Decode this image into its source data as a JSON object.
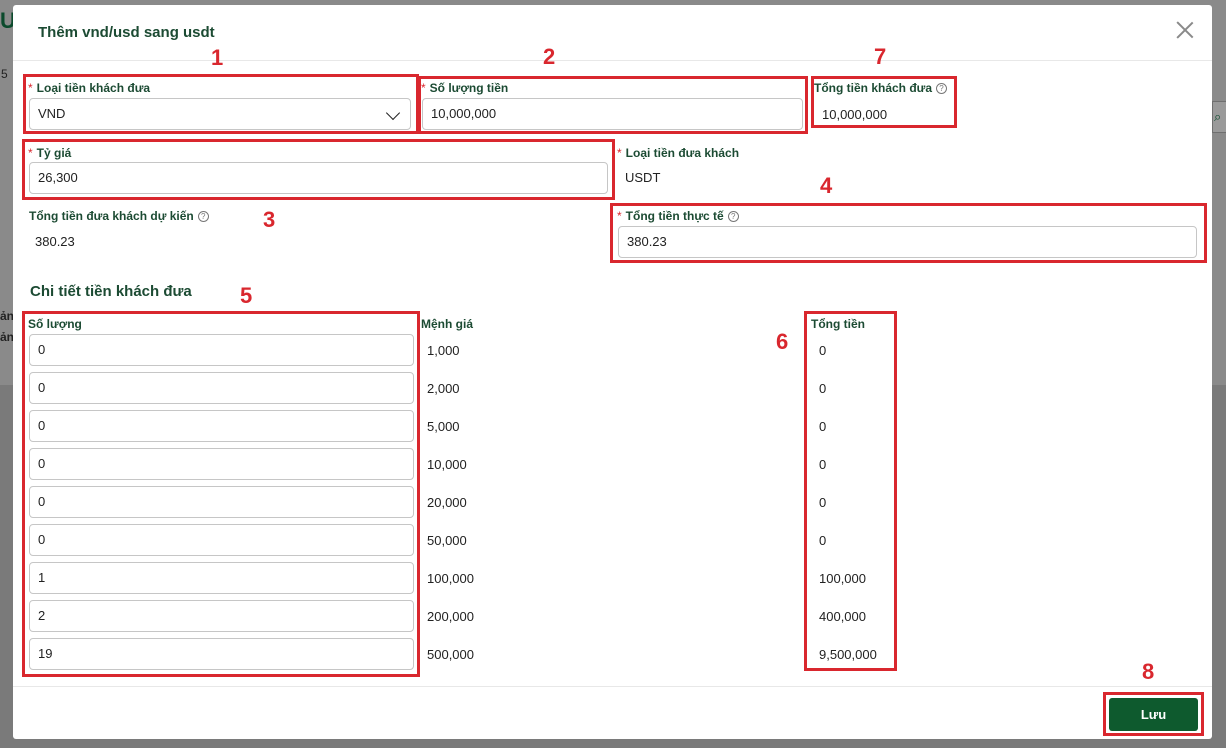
{
  "background": {
    "title_fragment": "US",
    "number_fragment": "5",
    "row_fragments": [
      "ản",
      "ản"
    ]
  },
  "modal": {
    "title": "Thêm vnd/usd sang usdt",
    "close_icon": "close-icon",
    "fields": {
      "currency_given": {
        "label": "Loại tiền khách đưa",
        "value": "VND",
        "required": "*"
      },
      "amount": {
        "label": "Số lượng tiền",
        "value": "10,000,000",
        "required": "*"
      },
      "total_given": {
        "label": "Tổng tiền khách đưa",
        "value": "10,000,000"
      },
      "rate": {
        "label": "Tỷ giá",
        "value": "26,300",
        "required": "*"
      },
      "currency_out": {
        "label": "Loại tiền đưa khách",
        "value": "USDT",
        "required": "*"
      },
      "expected_total": {
        "label": "Tổng tiền đưa khách dự kiến",
        "value": "380.23"
      },
      "actual_total": {
        "label": "Tổng tiền thực tế",
        "value": "380.23",
        "required": "*"
      }
    },
    "details": {
      "title": "Chi tiết tiền khách đưa",
      "headers": {
        "quantity": "Số lượng",
        "denomination": "Mệnh giá",
        "total": "Tổng tiền"
      },
      "rows": [
        {
          "quantity": "0",
          "denomination": "1,000",
          "total": "0"
        },
        {
          "quantity": "0",
          "denomination": "2,000",
          "total": "0"
        },
        {
          "quantity": "0",
          "denomination": "5,000",
          "total": "0"
        },
        {
          "quantity": "0",
          "denomination": "10,000",
          "total": "0"
        },
        {
          "quantity": "0",
          "denomination": "20,000",
          "total": "0"
        },
        {
          "quantity": "0",
          "denomination": "50,000",
          "total": "0"
        },
        {
          "quantity": "1",
          "denomination": "100,000",
          "total": "100,000"
        },
        {
          "quantity": "2",
          "denomination": "200,000",
          "total": "400,000"
        },
        {
          "quantity": "19",
          "denomination": "500,000",
          "total": "9,500,000"
        }
      ]
    },
    "save_label": "Lưu"
  },
  "annotations": [
    "1",
    "2",
    "7",
    "3",
    "4",
    "5",
    "6",
    "8"
  ],
  "colors": {
    "accent": "#1c4b33",
    "button": "#0e5a2e",
    "annotation": "#d9272e",
    "required": "#d9272e"
  }
}
